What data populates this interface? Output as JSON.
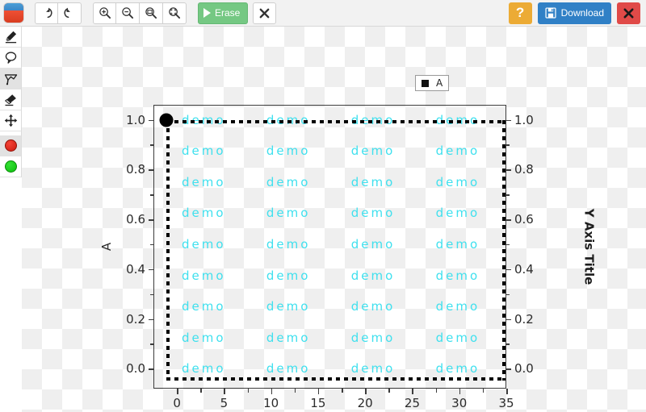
{
  "app": {
    "logo_icon": "app-logo-icon"
  },
  "toolbar": {
    "undo_icon": "undo-icon",
    "redo_icon": "redo-icon",
    "zoom_in_icon": "zoom-in-icon",
    "zoom_out_icon": "zoom-out-icon",
    "zoom_actual_icon": "zoom-actual-size-icon",
    "zoom_fit_icon": "zoom-fit-icon",
    "erase_label": "Erase",
    "erase_play_icon": "play-triangle-icon",
    "clear_icon": "close-x-icon",
    "help_label": "?",
    "download_label": "Download",
    "download_icon": "floppy-disk-icon",
    "close_icon": "close-x-icon",
    "accent_green": "#75c883",
    "accent_blue": "#3080c6",
    "accent_orange": "#ecab35",
    "accent_red": "#e04a48"
  },
  "sidebar": {
    "items": [
      {
        "name": "highlighter-pen-tool",
        "icon": "highlighter-icon",
        "active": false
      },
      {
        "name": "speech-bubble-tool",
        "icon": "speech-bubble-icon",
        "active": false
      },
      {
        "name": "polygon-lasso-tool",
        "icon": "polygon-flag-icon",
        "active": true
      },
      {
        "name": "eraser-tool",
        "icon": "eraser-icon",
        "active": false
      },
      {
        "name": "move-tool",
        "icon": "move-arrows-icon",
        "active": false
      }
    ],
    "swatches": [
      {
        "name": "color-swatch-red",
        "icon": "red-circle-icon",
        "color": "#ee2211",
        "active": true
      },
      {
        "name": "color-swatch-green",
        "icon": "green-circle-icon",
        "color": "#22cc22",
        "active": false
      }
    ]
  },
  "legend": {
    "marker_icon": "square-marker-icon",
    "entries": [
      "A"
    ]
  },
  "chart_data": {
    "type": "scatter",
    "title": "",
    "xlabel": "",
    "ylabel": "A",
    "y2label": "Y Axis Title",
    "xlim": [
      -2.5,
      35
    ],
    "ylim": [
      -0.08,
      1.06
    ],
    "xticks": [
      0,
      5,
      10,
      15,
      20,
      25,
      30,
      35
    ],
    "xticklabels": [
      "0",
      "5",
      "10",
      "15",
      "20",
      "25",
      "30",
      "35"
    ],
    "yticks": [
      0.0,
      0.2,
      0.4,
      0.6,
      0.8,
      1.0
    ],
    "yticklabels": [
      "0.0",
      "0.2",
      "0.4",
      "0.6",
      "0.8",
      "1.0"
    ],
    "y2ticks": [
      0.0,
      0.2,
      0.4,
      0.6,
      0.8,
      1.0
    ],
    "y2ticklabels": [
      "0.0",
      "0.2",
      "0.4",
      "0.6",
      "0.8",
      "1.0"
    ],
    "minor_ticks": true,
    "grid": false,
    "legend_position": "top-right",
    "series": [
      {
        "name": "A",
        "marker": "square",
        "color": "#111111",
        "values": []
      }
    ],
    "annotation_text": "demo",
    "annotation_color": "#3fe0ee",
    "annotation_columns_x": [
      0.5,
      9.5,
      18.5,
      27.5
    ],
    "annotation_rows_y": [
      1.0,
      0.875,
      0.75,
      0.625,
      0.5,
      0.375,
      0.25,
      0.125,
      0.0
    ]
  },
  "selection": {
    "name": "dotted-selection-box",
    "handle_icon": "resize-handle-dot-icon",
    "style": "dotted",
    "color": "#000000"
  }
}
